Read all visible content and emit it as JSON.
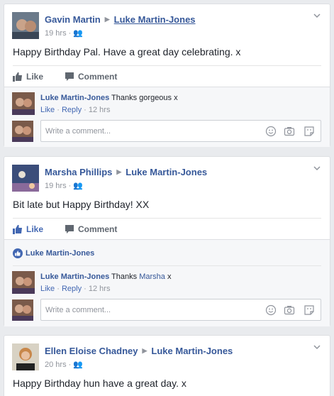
{
  "posts": [
    {
      "author": "Gavin Martin",
      "target": "Luke Martin-Jones",
      "time": "19 hrs",
      "text": "Happy Birthday Pal. Have a great day celebrating. x",
      "like_label": "Like",
      "comment_label": "Comment",
      "liked": false,
      "reply": {
        "author": "Luke Martin-Jones",
        "text": "Thanks gorgeous x",
        "like": "Like",
        "reply": "Reply",
        "time": "12 hrs"
      },
      "composer_placeholder": "Write a comment..."
    },
    {
      "author": "Marsha Phillips",
      "target": "Luke Martin-Jones",
      "time": "19 hrs",
      "text": "Bit late but Happy Birthday! XX",
      "like_label": "Like",
      "comment_label": "Comment",
      "liked": true,
      "liked_by": "Luke Martin-Jones",
      "reply": {
        "author": "Luke Martin-Jones",
        "text_before": "Thanks",
        "mention": "Marsha",
        "text_after": "x",
        "like": "Like",
        "reply": "Reply",
        "time": "12 hrs"
      },
      "composer_placeholder": "Write a comment..."
    },
    {
      "author": "Ellen Eloise Chadney",
      "target": "Luke Martin-Jones",
      "time": "20 hrs",
      "text": "Happy Birthday hun have a great day. x"
    }
  ],
  "colors": {
    "link": "#365899",
    "accent": "#4267b2",
    "muted": "#90949c",
    "background": "#e9ebee"
  }
}
